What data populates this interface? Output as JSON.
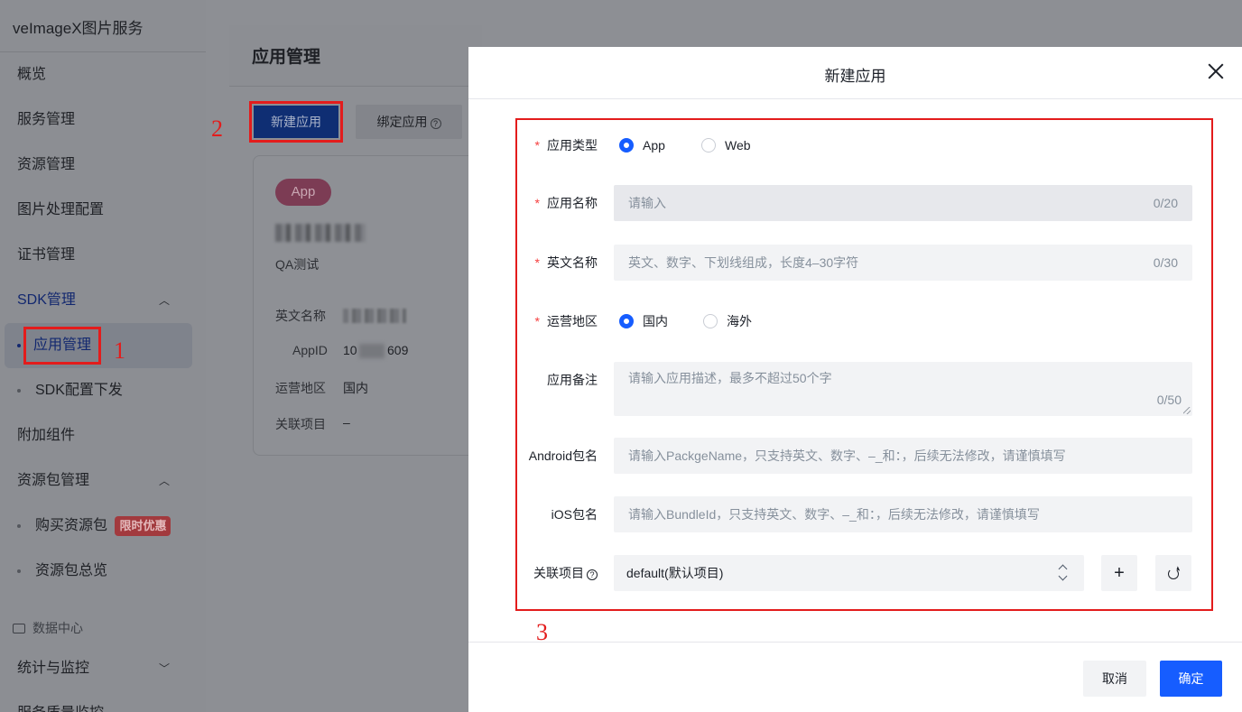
{
  "sidebar": {
    "brand": "veImageX图片服务",
    "items": {
      "overview": "概览",
      "service": "服务管理",
      "resource": "资源管理",
      "imgproc": "图片处理配置",
      "cert": "证书管理",
      "sdk": "SDK管理",
      "app_manage": "应用管理",
      "sdk_config": "SDK配置下发",
      "addon": "附加组件",
      "pkg": "资源包管理",
      "buy_pkg": "购买资源包",
      "promo_badge": "限时优惠",
      "pkg_overview": "资源包总览",
      "data_center": "数据中心",
      "stats": "统计与监控",
      "quality": "服务质量监控"
    }
  },
  "annotations": {
    "a1": "1",
    "a2": "2",
    "a3": "3"
  },
  "main": {
    "title": "应用管理",
    "new_app_btn": "新建应用",
    "bind_app_btn": "绑定应用",
    "card": {
      "type_badge": "App",
      "desc": "QA测试",
      "en_name_label": "英文名称",
      "appid_label": "AppID",
      "appid_prefix": "10",
      "appid_suffix": "609",
      "region_label": "运营地区",
      "region_value": "国内",
      "project_label": "关联项目",
      "project_value": "–"
    }
  },
  "drawer": {
    "title": "新建应用",
    "fields": {
      "app_type": {
        "label": "应用类型",
        "options": [
          "App",
          "Web"
        ],
        "selected": "App"
      },
      "app_name": {
        "label": "应用名称",
        "placeholder": "请输入",
        "count": "0/20"
      },
      "en_name": {
        "label": "英文名称",
        "placeholder": "英文、数字、下划线组成，长度4–30字符",
        "count": "0/30"
      },
      "region": {
        "label": "运营地区",
        "options": [
          "国内",
          "海外"
        ],
        "selected": "国内"
      },
      "remark": {
        "label": "应用备注",
        "placeholder": "请输入应用描述，最多不超过50个字",
        "count": "0/50"
      },
      "android_pkg": {
        "label": "Android包名",
        "placeholder": "请输入PackgeName，只支持英文、数字、–_和：，后续无法修改，请谨慎填写"
      },
      "ios_pkg": {
        "label": "iOS包名",
        "placeholder": "请输入BundleId，只支持英文、数字、–_和：，后续无法修改，请谨慎填写"
      },
      "project": {
        "label": "关联项目",
        "value": "default(默认项目)"
      }
    },
    "add_symbol": "+",
    "cancel_btn": "取消",
    "ok_btn": "确定"
  },
  "colors": {
    "primary": "#165dff",
    "danger": "#f53f3f",
    "annotation": "#e31c1c"
  }
}
